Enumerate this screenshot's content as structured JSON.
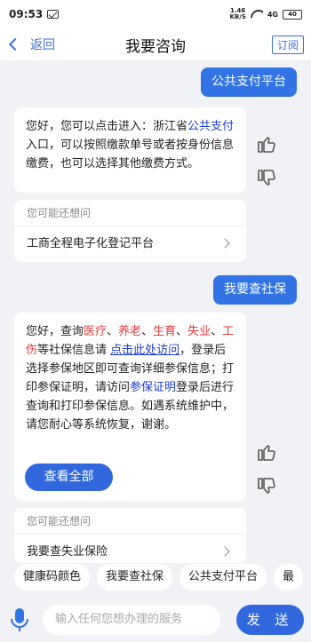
{
  "status": {
    "time": "09:53",
    "speed_top": "1.46",
    "speed_unit": "KB/S",
    "signal": "4G",
    "battery": "40"
  },
  "nav": {
    "back_label": "返回",
    "title": "我要咨询",
    "subscribe_label": "订阅"
  },
  "chat": [
    {
      "type": "user",
      "text": "公共支付平台"
    },
    {
      "type": "bot",
      "segments": [
        {
          "t": "您好，您可以点击进入：浙江省",
          "c": ""
        },
        {
          "t": "公共支付",
          "c": "blue"
        },
        {
          "t": "入口，可以按照缴款单号或者按身份信息缴费，也可以选择其他缴费方式。",
          "c": ""
        }
      ]
    },
    {
      "type": "suggest",
      "head": "您可能还想问",
      "items": [
        "工商全程电子化登记平台"
      ]
    },
    {
      "type": "user",
      "text": "我要查社保"
    },
    {
      "type": "bot",
      "segments": [
        {
          "t": "您好，查询",
          "c": ""
        },
        {
          "t": "医疗",
          "c": "red"
        },
        {
          "t": "、",
          "c": ""
        },
        {
          "t": "养老",
          "c": "red"
        },
        {
          "t": "、",
          "c": ""
        },
        {
          "t": "生育",
          "c": "red"
        },
        {
          "t": "、",
          "c": ""
        },
        {
          "t": "失业",
          "c": "red"
        },
        {
          "t": "、",
          "c": ""
        },
        {
          "t": "工伤",
          "c": "red"
        },
        {
          "t": "等社保信息请 ",
          "c": ""
        },
        {
          "t": "点击此处访问",
          "c": "blue-u"
        },
        {
          "t": "，登录后选择参保地区即可查询详细参保信息；打印参保证明，请访问",
          "c": ""
        },
        {
          "t": "参保证明",
          "c": "blue"
        },
        {
          "t": "登录后进行查询和打印参保信息。如遇系统维护中，请您耐心等系统恢复，谢谢。",
          "c": ""
        }
      ],
      "view_all": "查看全部"
    },
    {
      "type": "suggest",
      "head": "您可能还想问",
      "items": [
        "我要查失业保险"
      ]
    }
  ],
  "quick_chips": [
    "健康码颜色",
    "我要查社保",
    "公共支付平台",
    "最"
  ],
  "input": {
    "placeholder": "输入任何您想办理的服务",
    "send_label": "发 送"
  }
}
